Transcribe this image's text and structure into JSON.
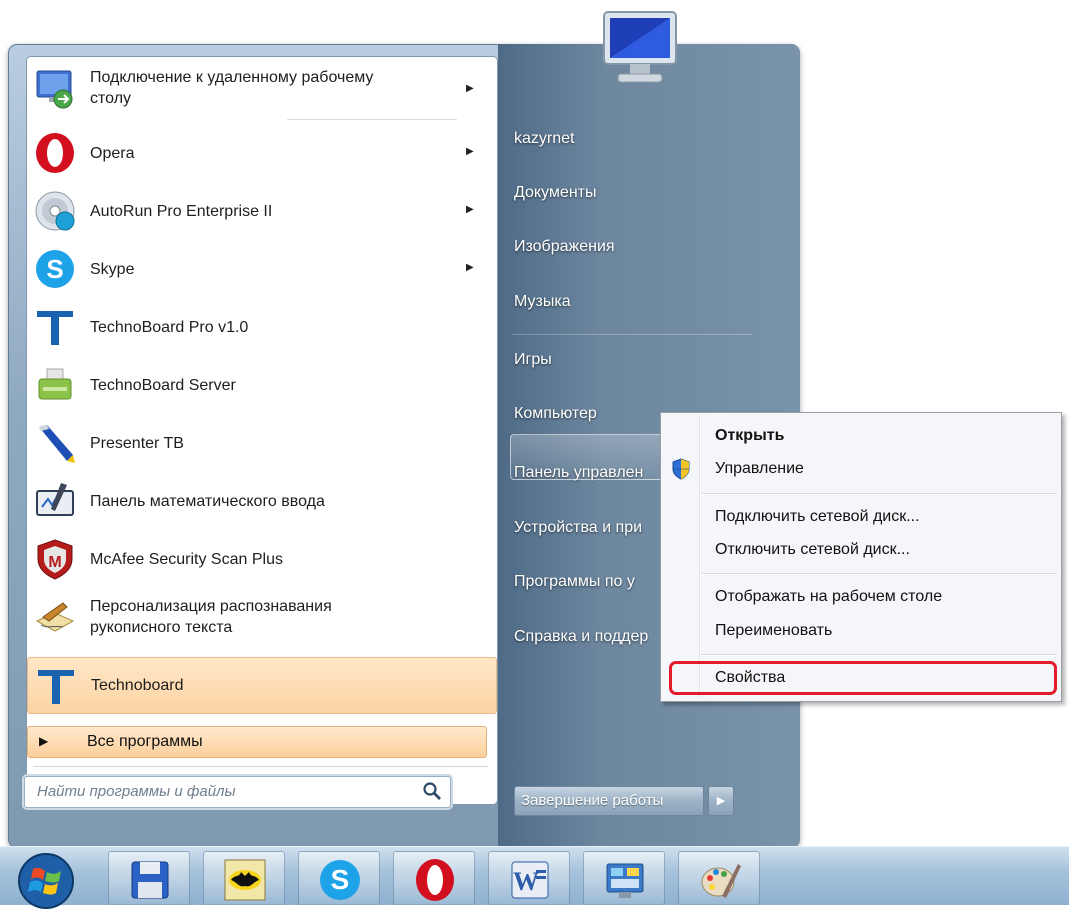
{
  "start_menu": {
    "programs": [
      {
        "label": "Подключение к удаленному рабочему\nстолу",
        "icon": "remote-desktop-icon",
        "arrow": true
      },
      {
        "label": "Opera",
        "icon": "opera-icon",
        "arrow": true
      },
      {
        "label": "AutoRun Pro Enterprise II",
        "icon": "autorun-disc-icon",
        "arrow": true
      },
      {
        "label": "Skype",
        "icon": "skype-icon",
        "arrow": true
      },
      {
        "label": "TechnoBoard Pro v1.0",
        "icon": "technoboard-icon",
        "arrow": false
      },
      {
        "label": "TechnoBoard Server",
        "icon": "usb-server-icon",
        "arrow": false
      },
      {
        "label": "Presenter TB",
        "icon": "pen-icon",
        "arrow": false
      },
      {
        "label": "Панель математического ввода",
        "icon": "math-input-icon",
        "arrow": false
      },
      {
        "label": "McAfee Security Scan Plus",
        "icon": "mcafee-shield-icon",
        "arrow": false
      },
      {
        "label": "Персонализация распознавания\nрукописного текста",
        "icon": "handwriting-icon",
        "arrow": false
      },
      {
        "label": "Technoboard",
        "icon": "technoboard-icon",
        "arrow": false
      }
    ],
    "all_programs_label": "Все программы",
    "search_placeholder": "Найти программы и файлы",
    "right_links": {
      "user": "kazyrnet",
      "documents": "Документы",
      "pictures": "Изображения",
      "music": "Музыка",
      "games": "Игры",
      "computer": "Компьютер",
      "control_panel": "Панель управлен",
      "devices": "Устройства и при",
      "default_programs": "Программы по у",
      "help": "Справка и поддер"
    },
    "shutdown_label": "Завершение работы"
  },
  "context_menu": {
    "open": "Открыть",
    "manage": "Управление",
    "map_drive": "Подключить сетевой диск...",
    "disconnect_drive": "Отключить сетевой диск...",
    "show_on_desktop": "Отображать на рабочем столе",
    "rename": "Переименовать",
    "properties": "Свойства",
    "highlight_color": "#e51b2b"
  },
  "taskbar": {
    "buttons": [
      "save-disk-icon",
      "batman-icon",
      "skype-icon",
      "opera-icon",
      "word-icon",
      "technoboard-app-icon",
      "paint-icon"
    ]
  }
}
